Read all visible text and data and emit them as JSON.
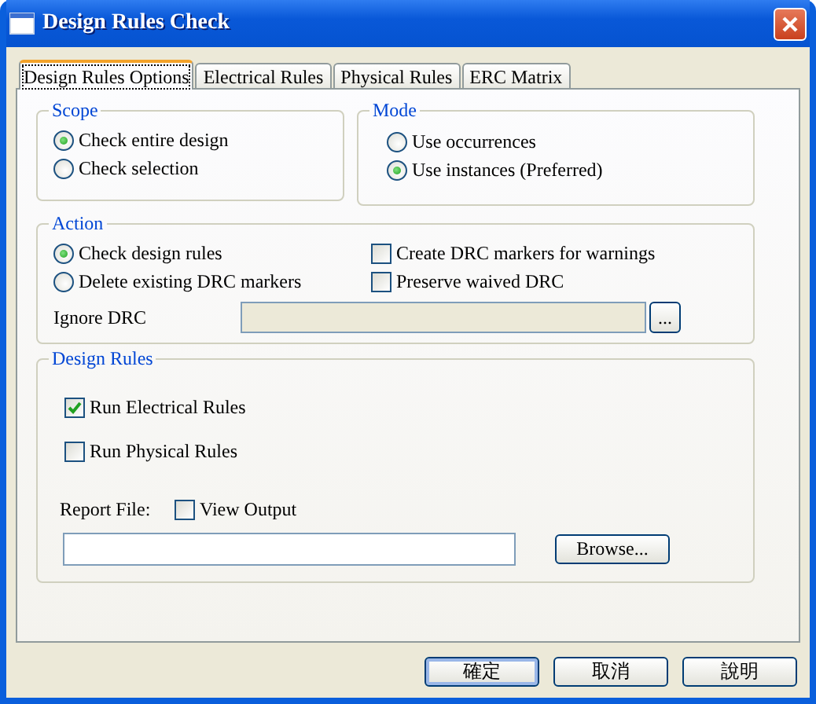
{
  "window": {
    "title": "Design Rules Check"
  },
  "tabs": [
    {
      "label": "Design Rules Options",
      "selected": true
    },
    {
      "label": "Electrical Rules",
      "selected": false
    },
    {
      "label": "Physical Rules",
      "selected": false
    },
    {
      "label": "ERC Matrix",
      "selected": false
    }
  ],
  "scope": {
    "title": "Scope",
    "options": [
      {
        "label": "Check entire design",
        "selected": true
      },
      {
        "label": "Check selection",
        "selected": false
      }
    ]
  },
  "mode": {
    "title": "Mode",
    "options": [
      {
        "label": "Use occurrences",
        "selected": false
      },
      {
        "label": "Use instances (Preferred)",
        "selected": true
      }
    ]
  },
  "action": {
    "title": "Action",
    "options": [
      {
        "label": "Check design rules",
        "selected": true
      },
      {
        "label": "Delete existing DRC markers",
        "selected": false
      }
    ],
    "checkboxes": [
      {
        "label": "Create DRC markers for warnings",
        "checked": false
      },
      {
        "label": "Preserve waived DRC",
        "checked": false
      }
    ],
    "ignore_drc": {
      "label": "Ignore DRC",
      "button": "..."
    }
  },
  "design_rules": {
    "title": "Design Rules",
    "checkboxes": [
      {
        "label": "Run Electrical Rules",
        "checked": true
      },
      {
        "label": "Run Physical Rules",
        "checked": false
      }
    ],
    "report_file": {
      "label": "Report File:",
      "view_output": {
        "label": "View Output",
        "checked": false
      },
      "button": "Browse..."
    }
  },
  "buttons": [
    {
      "label": "確定",
      "default": true
    },
    {
      "label": "取消",
      "default": false
    },
    {
      "label": "說明",
      "default": false
    }
  ]
}
